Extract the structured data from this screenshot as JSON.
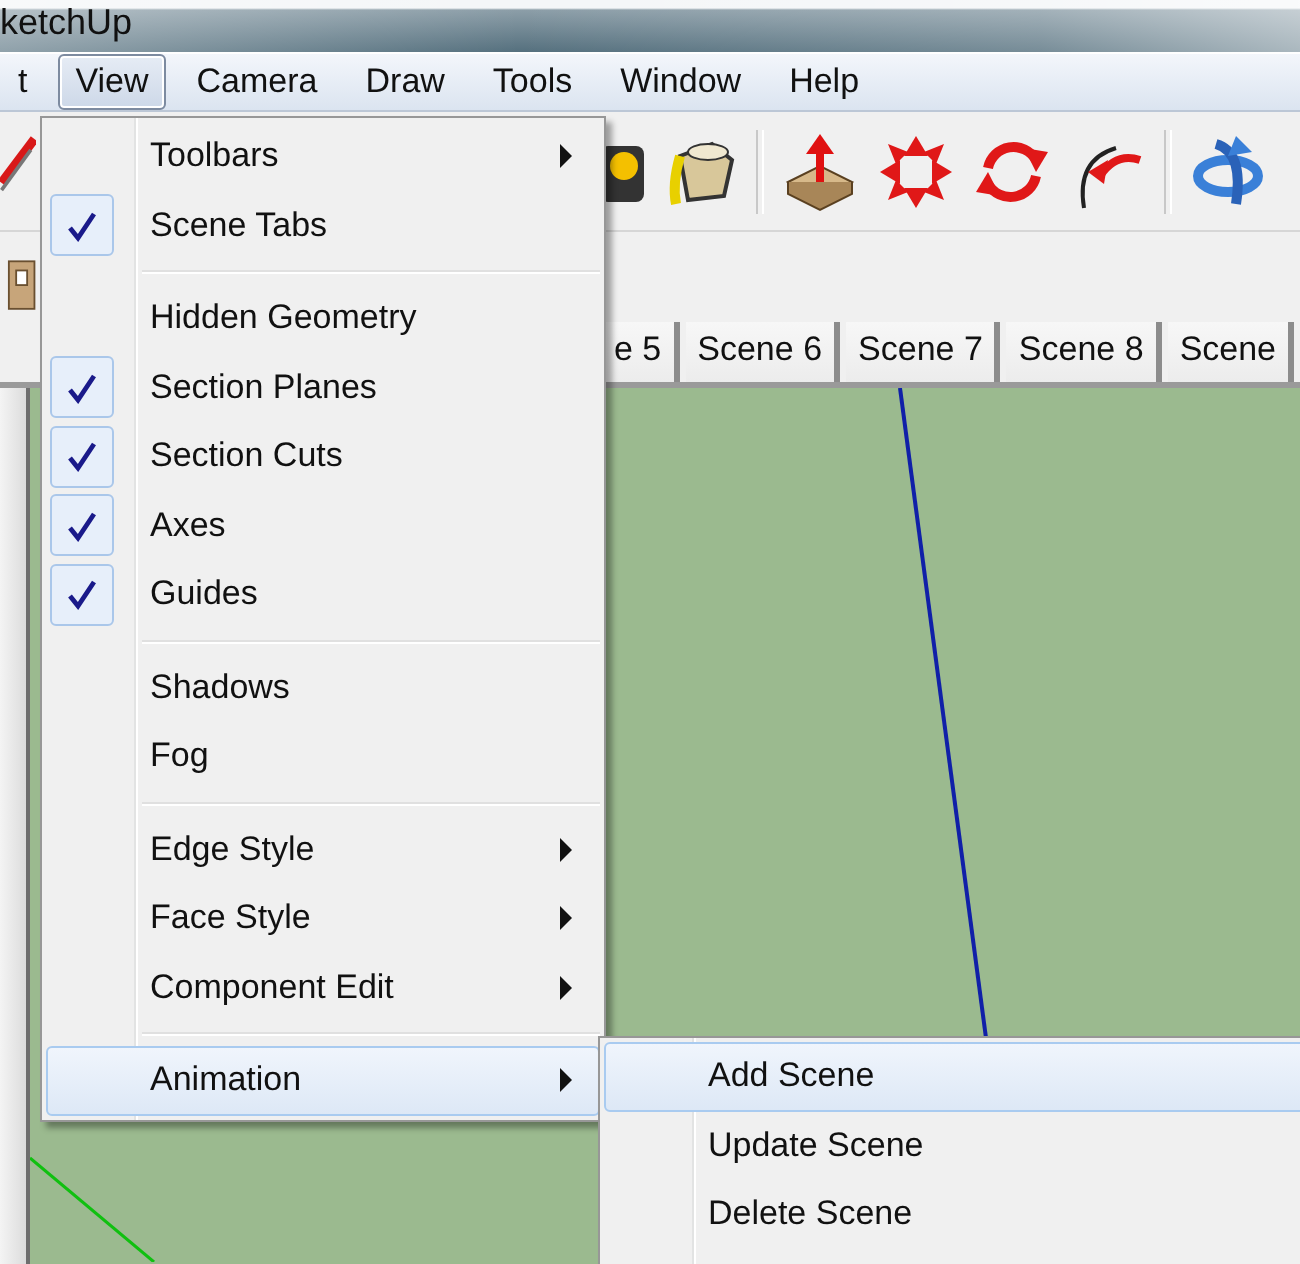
{
  "window": {
    "title": "ketchUp"
  },
  "menu_bar": [
    {
      "label": "t",
      "selected": false
    },
    {
      "label": "View",
      "selected": true
    },
    {
      "label": "Camera",
      "selected": false
    },
    {
      "label": "Draw",
      "selected": false
    },
    {
      "label": "Tools",
      "selected": false
    },
    {
      "label": "Window",
      "selected": false
    },
    {
      "label": "Help",
      "selected": false
    }
  ],
  "scene_tabs": [
    {
      "label": "e 5"
    },
    {
      "label": "Scene 6"
    },
    {
      "label": "Scene 7"
    },
    {
      "label": "Scene 8"
    },
    {
      "label": "Scene"
    }
  ],
  "view_menu": {
    "items": [
      {
        "kind": "item",
        "label": "Toolbars",
        "checked": false,
        "submenu": true,
        "selected": false
      },
      {
        "kind": "item",
        "label": "Scene Tabs",
        "checked": true,
        "submenu": false,
        "selected": false
      },
      {
        "kind": "separator"
      },
      {
        "kind": "item",
        "label": "Hidden Geometry",
        "checked": false,
        "submenu": false,
        "selected": false
      },
      {
        "kind": "item",
        "label": "Section Planes",
        "checked": true,
        "submenu": false,
        "selected": false
      },
      {
        "kind": "item",
        "label": "Section Cuts",
        "checked": true,
        "submenu": false,
        "selected": false
      },
      {
        "kind": "item",
        "label": "Axes",
        "checked": true,
        "submenu": false,
        "selected": false
      },
      {
        "kind": "item",
        "label": "Guides",
        "checked": true,
        "submenu": false,
        "selected": false
      },
      {
        "kind": "separator"
      },
      {
        "kind": "item",
        "label": "Shadows",
        "checked": false,
        "submenu": false,
        "selected": false
      },
      {
        "kind": "item",
        "label": "Fog",
        "checked": false,
        "submenu": false,
        "selected": false
      },
      {
        "kind": "separator"
      },
      {
        "kind": "item",
        "label": "Edge Style",
        "checked": false,
        "submenu": true,
        "selected": false
      },
      {
        "kind": "item",
        "label": "Face Style",
        "checked": false,
        "submenu": true,
        "selected": false
      },
      {
        "kind": "item",
        "label": "Component Edit",
        "checked": false,
        "submenu": true,
        "selected": false
      },
      {
        "kind": "separator"
      },
      {
        "kind": "item",
        "label": "Animation",
        "checked": false,
        "submenu": true,
        "selected": true
      }
    ]
  },
  "animation_submenu": {
    "items": [
      {
        "kind": "item",
        "label": "Add Scene",
        "selected": true
      },
      {
        "kind": "item",
        "label": "Update Scene",
        "selected": false
      },
      {
        "kind": "item",
        "label": "Delete Scene",
        "selected": false
      }
    ]
  }
}
